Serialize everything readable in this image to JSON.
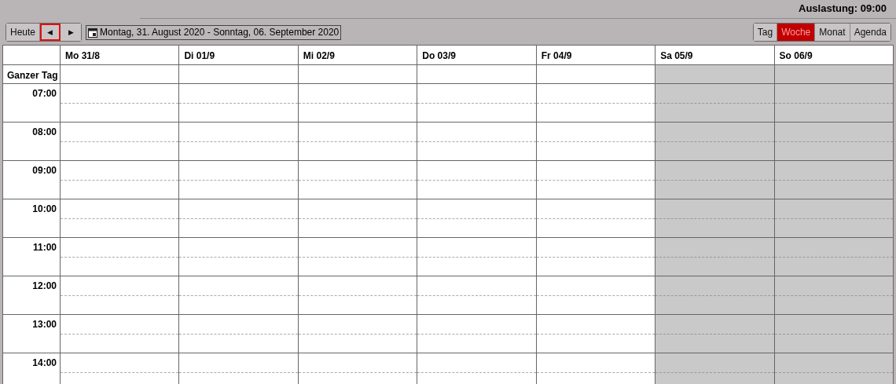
{
  "header": {
    "title": "Auslastung: 09:00"
  },
  "toolbar": {
    "today_button": "Heute",
    "nav_buttons": [
      {
        "label": "◀",
        "focused": true
      },
      {
        "label": "▶",
        "focused": false
      }
    ],
    "date_range": "Montag, 31. August 2020 - Sonntag, 06. September 2020",
    "views": [
      {
        "label": "Tag",
        "selected": false
      },
      {
        "label": "Woche",
        "selected": true
      },
      {
        "label": "Monat",
        "selected": false
      },
      {
        "label": "Agenda",
        "selected": false
      }
    ]
  },
  "calendar": {
    "all_day_label": "Ganzer Tag",
    "days": [
      {
        "label": "Mo 31/8",
        "weekend": false
      },
      {
        "label": "Di 01/9",
        "weekend": false
      },
      {
        "label": "Mi 02/9",
        "weekend": false
      },
      {
        "label": "Do 03/9",
        "weekend": false
      },
      {
        "label": "Fr 04/9",
        "weekend": false
      },
      {
        "label": "Sa 05/9",
        "weekend": true
      },
      {
        "label": "So 06/9",
        "weekend": true
      }
    ],
    "hours": [
      "07:00",
      "08:00",
      "09:00",
      "10:00",
      "11:00",
      "12:00",
      "13:00",
      "14:00"
    ]
  }
}
